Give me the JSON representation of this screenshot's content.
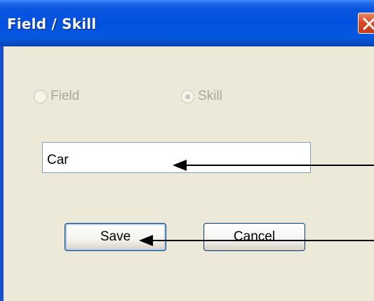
{
  "window": {
    "title": "Field / Skill",
    "close_icon": "close-icon"
  },
  "form": {
    "radio_field": {
      "label": "Field",
      "selected": false,
      "enabled": false
    },
    "radio_skill": {
      "label": "Skill",
      "selected": true,
      "enabled": false
    },
    "name_input": {
      "value": "Car"
    },
    "save_label": "Save",
    "cancel_label": "Cancel"
  },
  "colors": {
    "titlebar": "#0251e0",
    "dialog_bg": "#ece9d8",
    "disabled_text": "#aca899",
    "close_button": "#d84a24",
    "arrow": "#000000"
  }
}
